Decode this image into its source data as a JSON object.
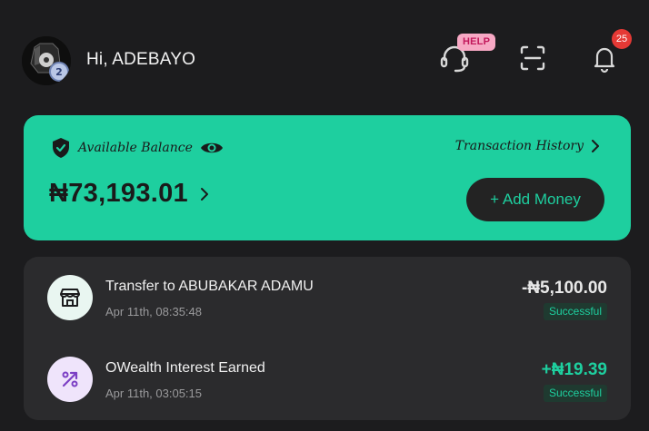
{
  "header": {
    "greeting": "Hi, ADEBAYO",
    "help_badge": "HELP",
    "notification_count": "25",
    "icons": [
      "avatar",
      "headset-icon",
      "scan-icon",
      "bell-icon"
    ]
  },
  "balance": {
    "label": "Available Balance",
    "history_label": "Transaction History",
    "amount": "₦73,193.01",
    "add_money_label": "+ Add Money",
    "card_color": "#1ecf9f"
  },
  "transactions": [
    {
      "title": "Transfer to ABUBAKAR ADAMU",
      "date": "Apr 11th, 08:35:48",
      "amount": "-₦5,100.00",
      "status": "Successful",
      "icon": "store-icon"
    },
    {
      "title": "OWealth Interest Earned",
      "date": "Apr 11th, 03:05:15",
      "amount": "+₦19.39",
      "status": "Successful",
      "icon": "percent-icon"
    }
  ]
}
